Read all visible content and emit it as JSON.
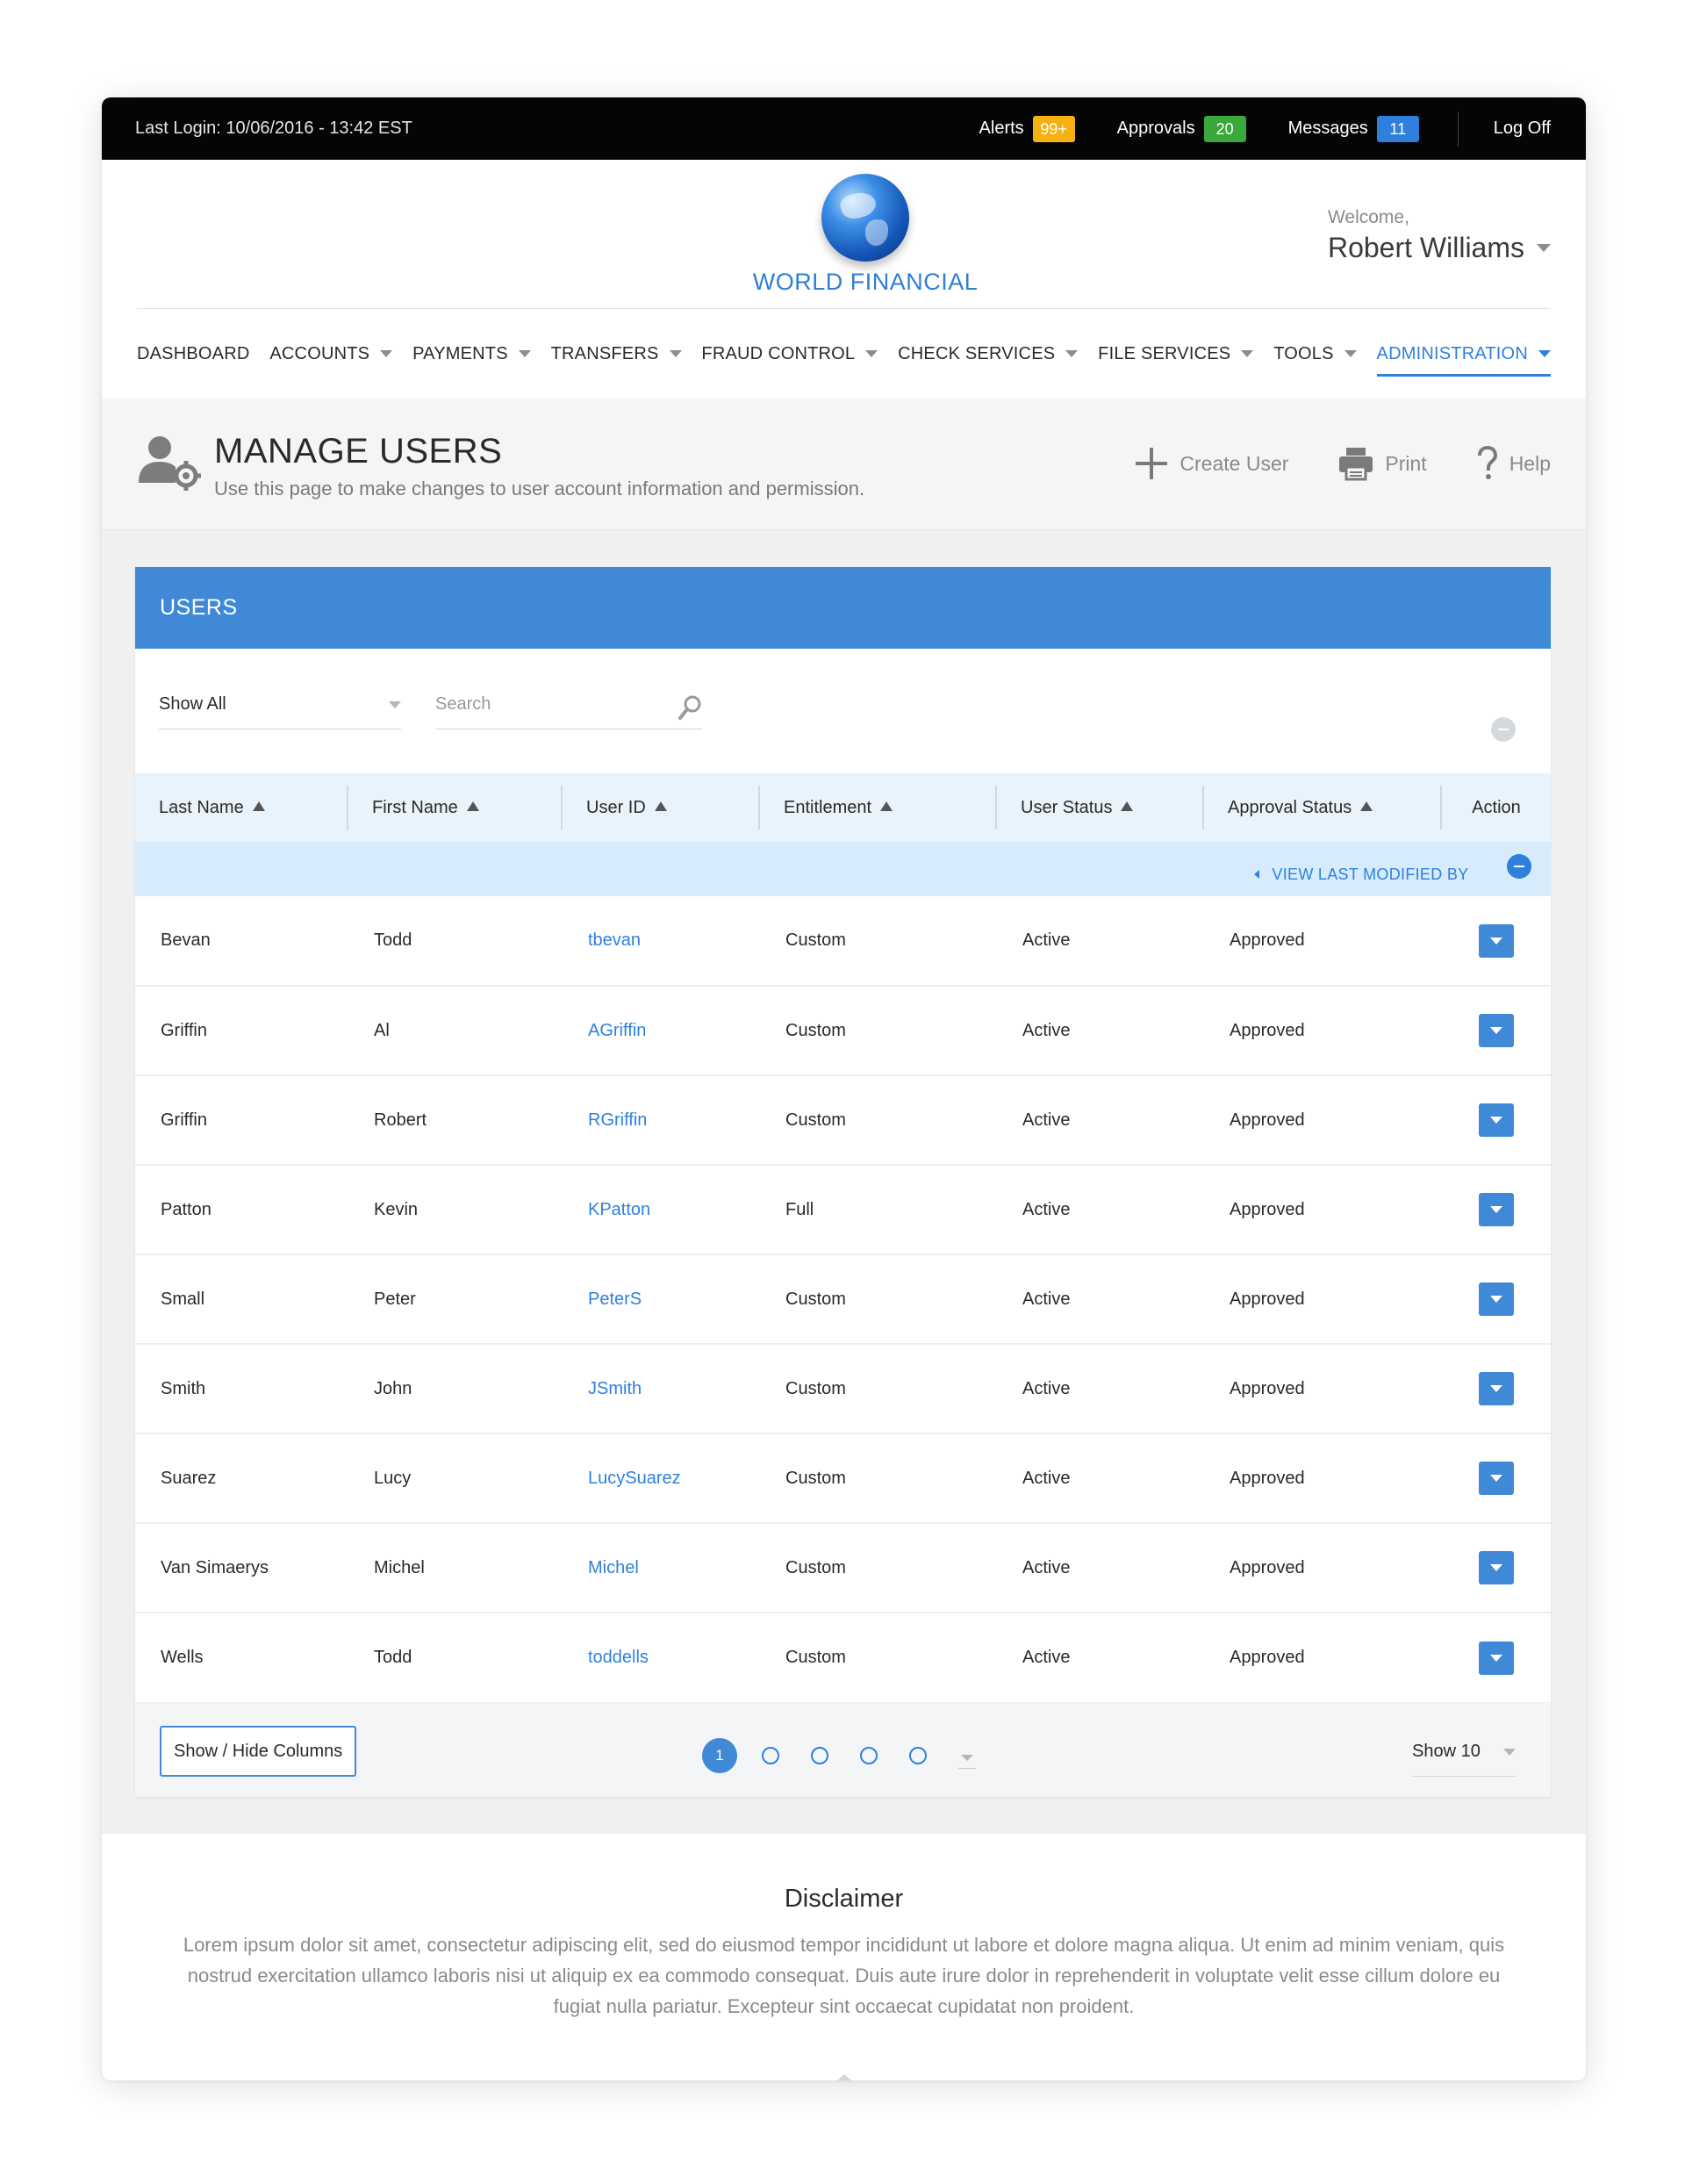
{
  "topbar": {
    "last_login": "Last Login: 10/06/2016 - 13:42 EST",
    "alerts_label": "Alerts",
    "alerts_count": "99+",
    "approvals_label": "Approvals",
    "approvals_count": "20",
    "messages_label": "Messages",
    "messages_count": "11",
    "logoff_label": "Log Off"
  },
  "header": {
    "brand": "WORLD FINANCIAL",
    "welcome_label": "Welcome,",
    "user_name": "Robert Williams"
  },
  "nav": {
    "items": [
      {
        "label": "DASHBOARD",
        "has_caret": false,
        "active": false
      },
      {
        "label": "ACCOUNTS",
        "has_caret": true,
        "active": false
      },
      {
        "label": "PAYMENTS",
        "has_caret": true,
        "active": false
      },
      {
        "label": "TRANSFERS",
        "has_caret": true,
        "active": false
      },
      {
        "label": "FRAUD CONTROL",
        "has_caret": true,
        "active": false
      },
      {
        "label": "CHECK SERVICES",
        "has_caret": true,
        "active": false
      },
      {
        "label": "FILE SERVICES",
        "has_caret": true,
        "active": false
      },
      {
        "label": "TOOLS",
        "has_caret": true,
        "active": false
      },
      {
        "label": "ADMINISTRATION",
        "has_caret": true,
        "active": true
      }
    ]
  },
  "page": {
    "title": "MANAGE USERS",
    "subtitle": "Use this page to make changes to user account information and permission.",
    "actions": {
      "create": "Create User",
      "print": "Print",
      "help": "Help"
    }
  },
  "panel": {
    "title": "USERS",
    "filter_value": "Show All",
    "search_placeholder": "Search"
  },
  "table": {
    "columns": [
      "Last Name",
      "First Name",
      "User ID",
      "Entitlement",
      "User Status",
      "Approval Status",
      "Action"
    ],
    "view_last_modified": "VIEW LAST MODIFIED BY",
    "rows": [
      {
        "last": "Bevan",
        "first": "Todd",
        "uid": "tbevan",
        "ent": "Custom",
        "status": "Active",
        "approval": "Approved"
      },
      {
        "last": "Griffin",
        "first": "Al",
        "uid": "AGriffin",
        "ent": "Custom",
        "status": "Active",
        "approval": "Approved"
      },
      {
        "last": "Griffin",
        "first": "Robert",
        "uid": "RGriffin",
        "ent": "Custom",
        "status": "Active",
        "approval": "Approved"
      },
      {
        "last": "Patton",
        "first": "Kevin",
        "uid": "KPatton",
        "ent": "Full",
        "status": "Active",
        "approval": "Approved"
      },
      {
        "last": "Small",
        "first": "Peter",
        "uid": "PeterS",
        "ent": "Custom",
        "status": "Active",
        "approval": "Approved"
      },
      {
        "last": "Smith",
        "first": "John",
        "uid": "JSmith",
        "ent": "Custom",
        "status": "Active",
        "approval": "Approved"
      },
      {
        "last": "Suarez",
        "first": "Lucy",
        "uid": "LucySuarez",
        "ent": "Custom",
        "status": "Active",
        "approval": "Approved"
      },
      {
        "last": "Van Simaerys",
        "first": "Michel",
        "uid": "Michel",
        "ent": "Custom",
        "status": "Active",
        "approval": "Approved"
      },
      {
        "last": "Wells",
        "first": "Todd",
        "uid": "toddells",
        "ent": "Custom",
        "status": "Active",
        "approval": "Approved"
      }
    ]
  },
  "footer": {
    "show_hide_label": "Show / Hide Columns",
    "current_page": "1",
    "page_size": "Show 10"
  },
  "disclaimer": {
    "title": "Disclaimer",
    "text": "Lorem ipsum dolor sit amet, consectetur adipiscing elit, sed do eiusmod tempor incididunt ut labore et dolore magna aliqua. Ut enim ad minim veniam, quis nostrud exercitation ullamco laboris nisi ut aliquip ex ea commodo consequat. Duis aute irure dolor in reprehenderit in voluptate velit esse cillum dolore eu fugiat nulla pariatur. Excepteur sint occaecat cupidatat non proident."
  },
  "colors": {
    "accent": "#3f89d7",
    "link": "#2f80de",
    "alerts_badge": "#f4b10f",
    "approvals_badge": "#3aa83b",
    "messages_badge": "#2f80de"
  }
}
